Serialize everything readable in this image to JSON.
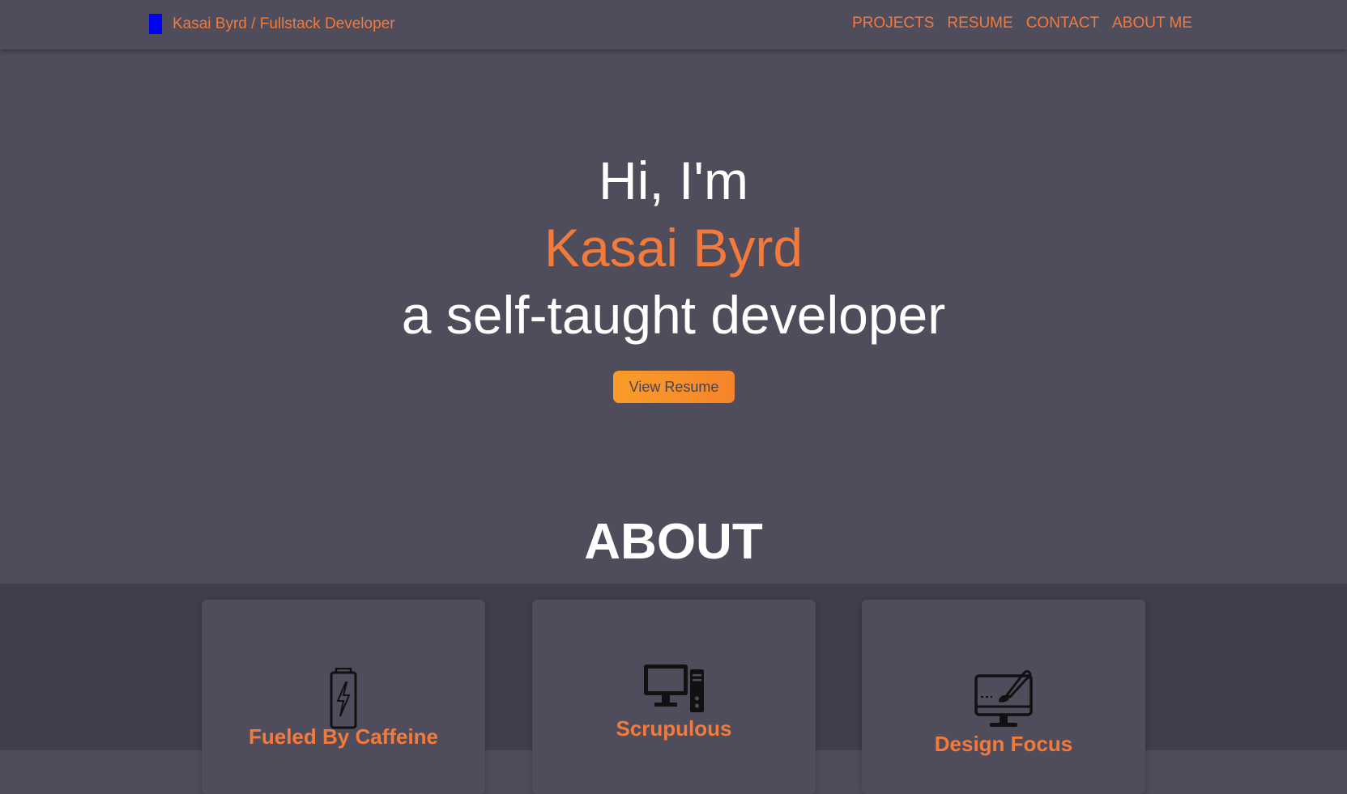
{
  "navbar": {
    "brand": "Kasai Byrd / Fullstack Developer",
    "brand_logo_color": "#0000ff",
    "links": [
      "PROJECTS",
      "RESUME",
      "CONTACT",
      "ABOUT ME"
    ]
  },
  "hero": {
    "greeting": "Hi, I'm",
    "name": "Kasai Byrd",
    "tagline": "a self-taught developer",
    "button_label": "View Resume"
  },
  "about": {
    "title": "ABOUT",
    "cards": [
      {
        "title": "Fueled By Caffeine",
        "icon": "energy-drink-can-icon"
      },
      {
        "title": "Scrupulous",
        "icon": "desktop-computer-icon"
      },
      {
        "title": "Design Focus",
        "icon": "monitor-paintbrush-icon"
      }
    ]
  },
  "colors": {
    "background": "#4f4d5b",
    "band_background": "#403e4b",
    "accent": "#f47a3c",
    "button_gradient_start": "#f99c2a",
    "button_gradient_end": "#f5842a"
  }
}
